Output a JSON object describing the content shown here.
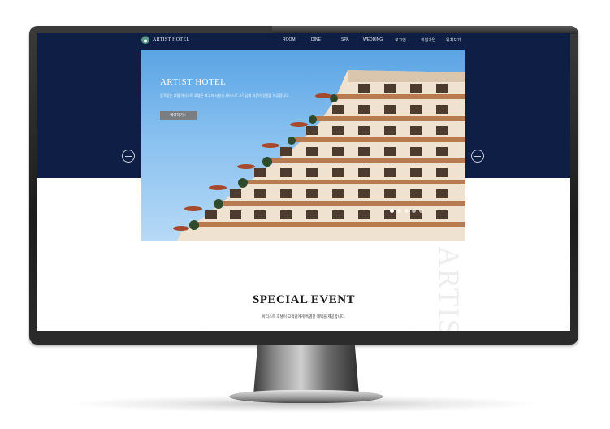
{
  "brand": {
    "name": "ARTIST HOTEL",
    "logo_icon": "hotel-logo-icon"
  },
  "nav": {
    "items": [
      "ROOM",
      "DINE",
      "SPA",
      "WEDDING",
      "로그인",
      "회원가입",
      "위치보기"
    ]
  },
  "hero": {
    "title": "ARTIST HOTEL",
    "description": "품격있는 호텔 아티스트 호텔은 최고의 시설과 서비스로 고객님께 최상의 경험을 제공합니다.",
    "button_label": "예약하기 >",
    "slide_count": 5,
    "active_slide": 1
  },
  "decor_word": "ARTIST",
  "special": {
    "title": "SPECIAL EVENT",
    "subtitle": "아티스트 호텔이 고객님에게 특별한 혜택을 제공합니다."
  },
  "colors": {
    "hero_band": "#0f1e45",
    "accent": "#7a7d82"
  }
}
